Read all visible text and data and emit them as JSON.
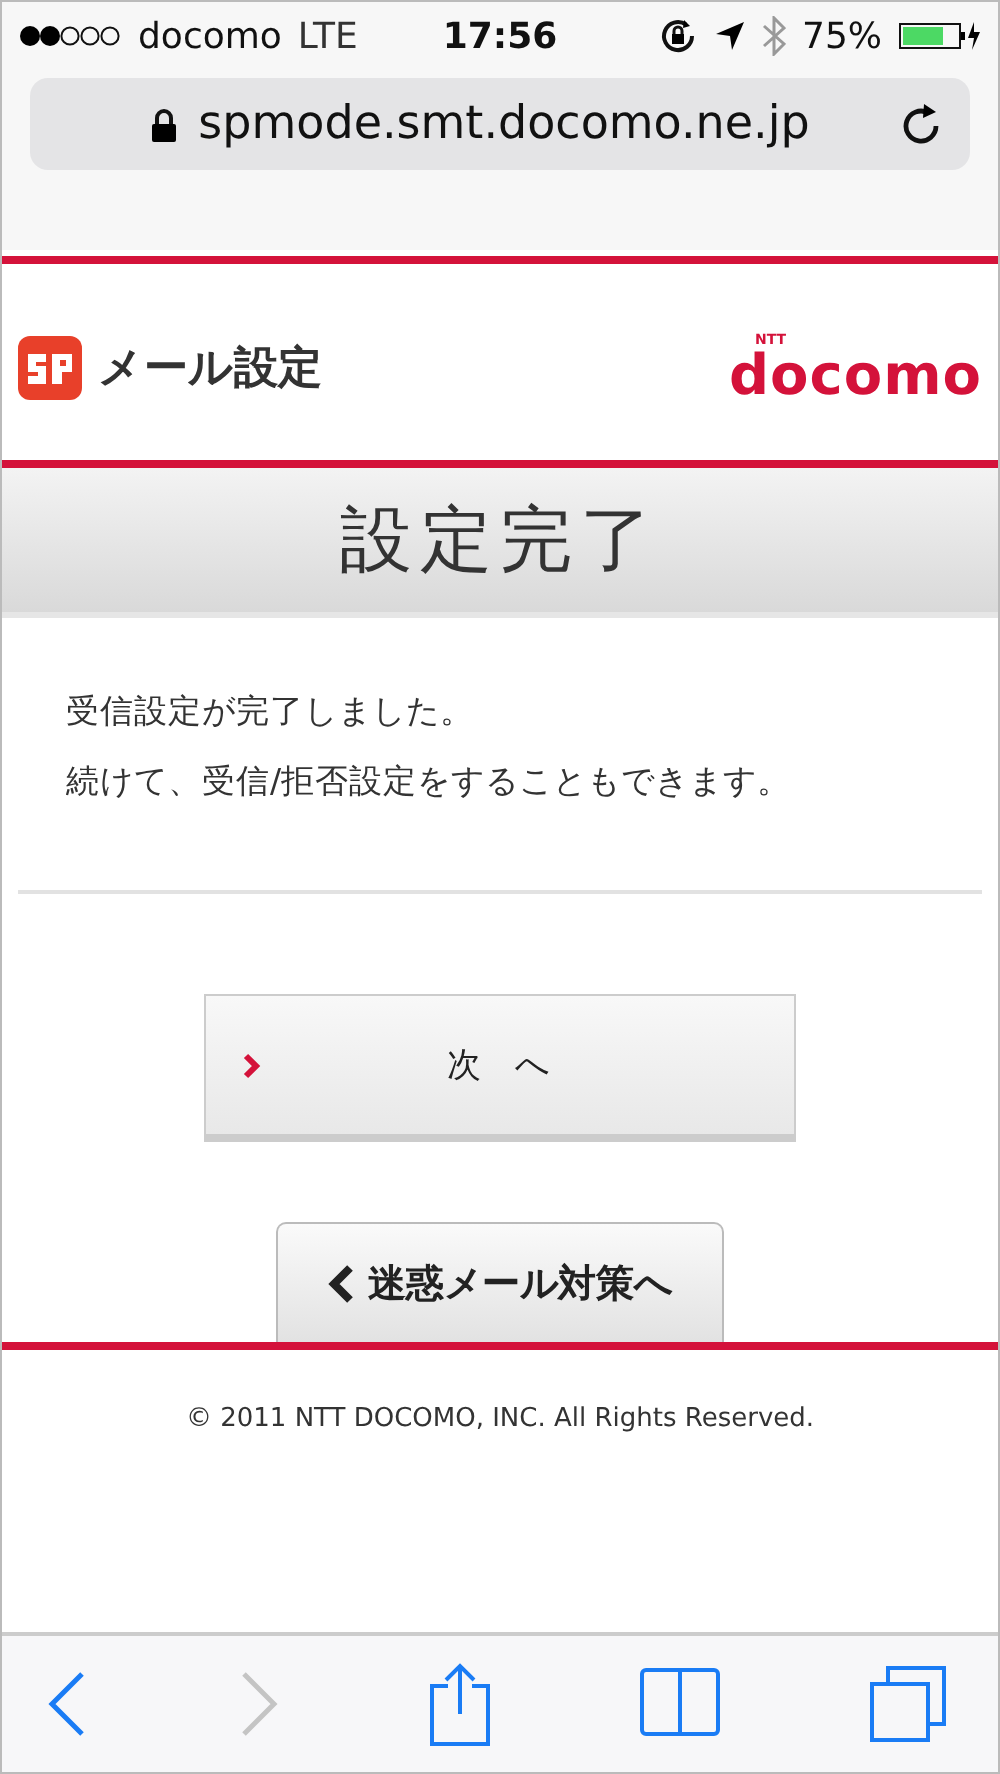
{
  "status_bar": {
    "carrier": "docomo",
    "network": "LTE",
    "time": "17:56",
    "battery": "75%"
  },
  "address_bar": {
    "url": "spmode.smt.docomo.ne.jp"
  },
  "header": {
    "title": "メール設定",
    "brand_mark": "NTT",
    "brand": "docomo"
  },
  "page_title": "設定完了",
  "message": [
    "受信設定が完了しました。",
    "続けて、受信/拒否設定をすることもできます。"
  ],
  "buttons": [
    {
      "kind": "next",
      "label": "次　へ"
    },
    {
      "kind": "back",
      "label": "迷惑メール対策へ"
    }
  ],
  "copyright": "© 2011 NTT DOCOMO, INC. All Rights Reserved.",
  "toolbar": [
    {
      "kind": "back",
      "disabled": false
    },
    {
      "kind": "forward",
      "disabled": true
    },
    {
      "kind": "share",
      "disabled": false
    },
    {
      "kind": "bookmarks",
      "disabled": false
    },
    {
      "kind": "tabs",
      "disabled": false
    }
  ]
}
